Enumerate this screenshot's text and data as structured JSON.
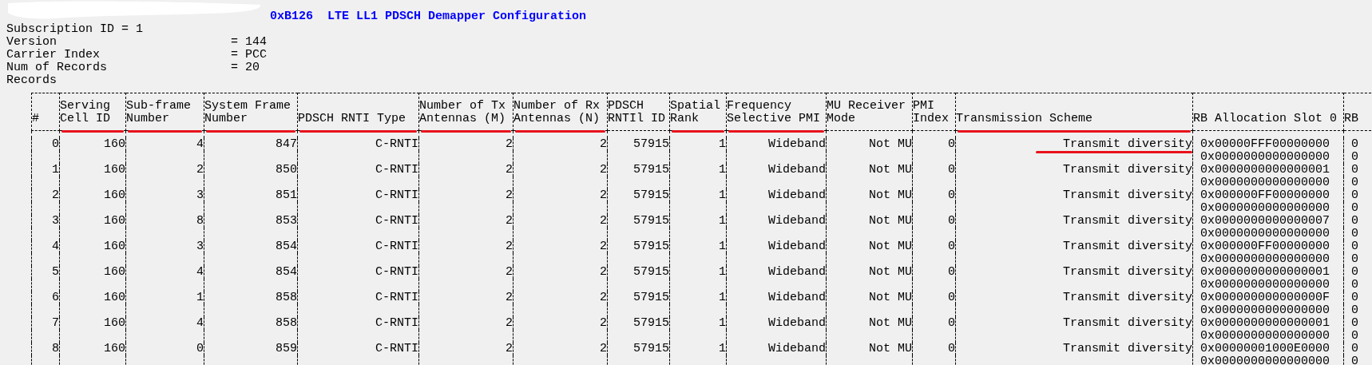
{
  "title": "0xB126  LTE LL1 PDSCH Demapper Configuration",
  "fields": [
    {
      "kind": "compact",
      "label": "Subscription ID",
      "value": "= 1"
    },
    {
      "kind": "aligned",
      "label": "Version",
      "value": "= 144"
    },
    {
      "kind": "aligned",
      "label": "Carrier Index",
      "value": "= PCC"
    },
    {
      "kind": "aligned",
      "label": "Num of Records",
      "value": "= 20"
    }
  ],
  "records_label": "Records",
  "table": {
    "columns": [
      {
        "lines": [
          "#"
        ],
        "kind": "value",
        "underlined": false
      },
      {
        "lines": [
          "Serving",
          "Cell ID"
        ],
        "kind": "value",
        "underlined": true
      },
      {
        "lines": [
          "Sub-frame",
          "Number"
        ],
        "kind": "value",
        "underlined": true
      },
      {
        "lines": [
          "System Frame",
          "Number"
        ],
        "kind": "value",
        "underlined": true
      },
      {
        "lines": [
          "PDSCH RNTI Type"
        ],
        "kind": "value",
        "underlined": true
      },
      {
        "lines": [
          "Number of Tx",
          "Antennas (M)"
        ],
        "kind": "value",
        "underlined": true
      },
      {
        "lines": [
          "Number of Rx",
          "Antennas (N)"
        ],
        "kind": "value",
        "underlined": true
      },
      {
        "lines": [
          "PDSCH",
          "RNTIl ID"
        ],
        "kind": "value",
        "underlined": false
      },
      {
        "lines": [
          "Spatial",
          "Rank"
        ],
        "kind": "value",
        "underlined": true
      },
      {
        "lines": [
          "Frequency",
          "Selective PMI"
        ],
        "kind": "value",
        "underlined": true
      },
      {
        "lines": [
          "MU Receiver",
          "Mode"
        ],
        "kind": "value",
        "underlined": false
      },
      {
        "lines": [
          "PMI",
          "Index"
        ],
        "kind": "value",
        "underlined": false
      },
      {
        "lines": [
          "Transmission Scheme"
        ],
        "kind": "value",
        "underlined": true
      },
      {
        "lines": [
          "RB Allocation Slot 0"
        ],
        "kind": "hex",
        "underlined": false
      },
      {
        "lines": [
          "RB"
        ],
        "kind": "hex",
        "underlined": false
      }
    ],
    "rows": [
      {
        "cells": [
          "0",
          "160",
          "4",
          "847",
          "C-RNTI",
          "2",
          "2",
          "57915",
          "1",
          "Wideband",
          "Not MU",
          "0",
          "Transmit diversity",
          "0x00000FFF00000000",
          "0"
        ],
        "continuation": [
          "0x0000000000000000",
          "0"
        ],
        "scheme_underlined": true
      },
      {
        "cells": [
          "1",
          "160",
          "2",
          "850",
          "C-RNTI",
          "2",
          "2",
          "57915",
          "1",
          "Wideband",
          "Not MU",
          "0",
          "Transmit diversity",
          "0x0000000000000001",
          "0"
        ],
        "continuation": [
          "0x0000000000000000",
          "0"
        ],
        "scheme_underlined": false
      },
      {
        "cells": [
          "2",
          "160",
          "3",
          "851",
          "C-RNTI",
          "2",
          "2",
          "57915",
          "1",
          "Wideband",
          "Not MU",
          "0",
          "Transmit diversity",
          "0x000000FF00000000",
          "0"
        ],
        "continuation": [
          "0x0000000000000000",
          "0"
        ],
        "scheme_underlined": false
      },
      {
        "cells": [
          "3",
          "160",
          "8",
          "853",
          "C-RNTI",
          "2",
          "2",
          "57915",
          "1",
          "Wideband",
          "Not MU",
          "0",
          "Transmit diversity",
          "0x0000000000000007",
          "0"
        ],
        "continuation": [
          "0x0000000000000000",
          "0"
        ],
        "scheme_underlined": false
      },
      {
        "cells": [
          "4",
          "160",
          "3",
          "854",
          "C-RNTI",
          "2",
          "2",
          "57915",
          "1",
          "Wideband",
          "Not MU",
          "0",
          "Transmit diversity",
          "0x000000FF00000000",
          "0"
        ],
        "continuation": [
          "0x0000000000000000",
          "0"
        ],
        "scheme_underlined": false
      },
      {
        "cells": [
          "5",
          "160",
          "4",
          "854",
          "C-RNTI",
          "2",
          "2",
          "57915",
          "1",
          "Wideband",
          "Not MU",
          "0",
          "Transmit diversity",
          "0x0000000000000001",
          "0"
        ],
        "continuation": [
          "0x0000000000000000",
          "0"
        ],
        "scheme_underlined": false
      },
      {
        "cells": [
          "6",
          "160",
          "1",
          "858",
          "C-RNTI",
          "2",
          "2",
          "57915",
          "1",
          "Wideband",
          "Not MU",
          "0",
          "Transmit diversity",
          "0x000000000000000F",
          "0"
        ],
        "continuation": [
          "0x0000000000000000",
          "0"
        ],
        "scheme_underlined": false
      },
      {
        "cells": [
          "7",
          "160",
          "4",
          "858",
          "C-RNTI",
          "2",
          "2",
          "57915",
          "1",
          "Wideband",
          "Not MU",
          "0",
          "Transmit diversity",
          "0x0000000000000001",
          "0"
        ],
        "continuation": [
          "0x0000000000000000",
          "0"
        ],
        "scheme_underlined": false
      },
      {
        "cells": [
          "8",
          "160",
          "0",
          "859",
          "C-RNTI",
          "2",
          "2",
          "57915",
          "1",
          "Wideband",
          "Not MU",
          "0",
          "Transmit diversity",
          "0x00000001000E0000",
          "0"
        ],
        "continuation": [
          "0x0000000000000000",
          "0"
        ],
        "scheme_underlined": false
      }
    ]
  }
}
